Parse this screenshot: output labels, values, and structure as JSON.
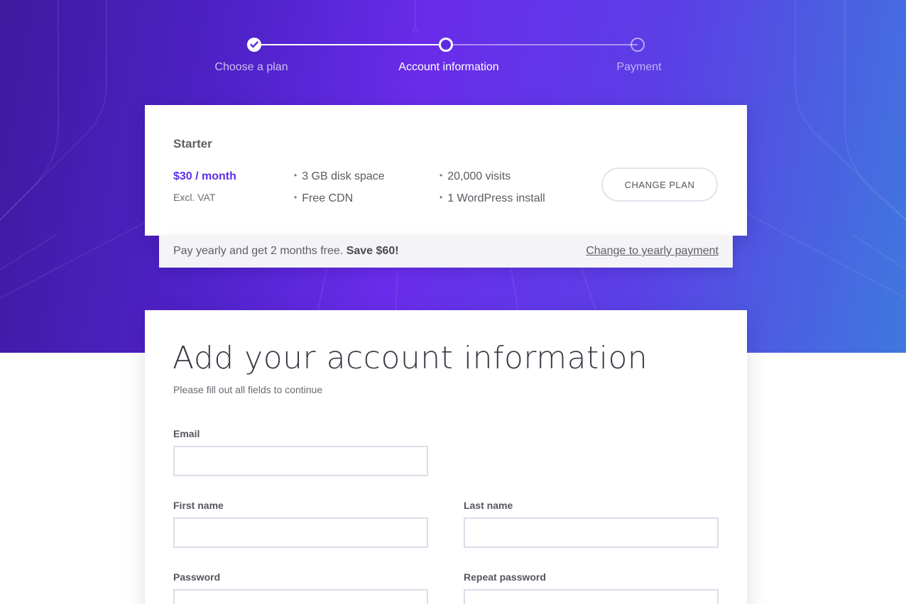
{
  "stepper": {
    "steps": [
      {
        "label": "Choose a plan",
        "state": "done"
      },
      {
        "label": "Account information",
        "state": "active"
      },
      {
        "label": "Payment",
        "state": "pending"
      }
    ]
  },
  "plan": {
    "name": "Starter",
    "price": "$30 / month",
    "vat_note": "Excl. VAT",
    "features": [
      "3 GB disk space",
      "Free CDN",
      "20,000 visits",
      "1 WordPress install"
    ],
    "change_button": "CHANGE PLAN"
  },
  "yearly": {
    "text": "Pay yearly and get 2 months free.",
    "highlight": "Save $60!",
    "link": "Change to yearly payment"
  },
  "form": {
    "title": "Add your account information",
    "subtitle": "Please fill out all fields to continue",
    "fields": {
      "email": {
        "label": "Email",
        "value": ""
      },
      "first_name": {
        "label": "First name",
        "value": ""
      },
      "last_name": {
        "label": "Last name",
        "value": ""
      },
      "password": {
        "label": "Password",
        "value": ""
      },
      "repeat_password": {
        "label": "Repeat password",
        "value": ""
      }
    }
  },
  "colors": {
    "accent": "#5b2ee6",
    "hero_start": "#3d1a9e",
    "hero_mid": "#6a2cea",
    "hero_end": "#3f78de"
  }
}
